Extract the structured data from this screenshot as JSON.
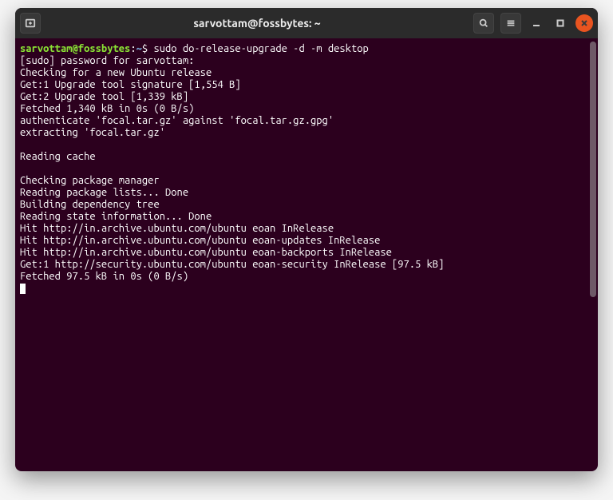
{
  "window": {
    "title": "sarvottam@fossbytes: ~"
  },
  "prompt": {
    "user_host": "sarvottam@fossbytes",
    "separator": ":",
    "path": "~",
    "symbol": "$ "
  },
  "command": "sudo do-release-upgrade -d -m desktop",
  "output": {
    "l1": "[sudo] password for sarvottam:",
    "l2": "Checking for a new Ubuntu release",
    "l3": "Get:1 Upgrade tool signature [1,554 B]",
    "l4": "Get:2 Upgrade tool [1,339 kB]",
    "l5": "Fetched 1,340 kB in 0s (0 B/s)",
    "l6": "authenticate 'focal.tar.gz' against 'focal.tar.gz.gpg'",
    "l7": "extracting 'focal.tar.gz'",
    "l8": "",
    "l9": "Reading cache",
    "l10": "",
    "l11": "Checking package manager",
    "l12": "Reading package lists... Done",
    "l13": "Building dependency tree",
    "l14": "Reading state information... Done",
    "l15": "Hit http://in.archive.ubuntu.com/ubuntu eoan InRelease",
    "l16": "Hit http://in.archive.ubuntu.com/ubuntu eoan-updates InRelease",
    "l17": "Hit http://in.archive.ubuntu.com/ubuntu eoan-backports InRelease",
    "l18": "Get:1 http://security.ubuntu.com/ubuntu eoan-security InRelease [97.5 kB]",
    "l19": "Fetched 97.5 kB in 0s (0 B/s)"
  }
}
